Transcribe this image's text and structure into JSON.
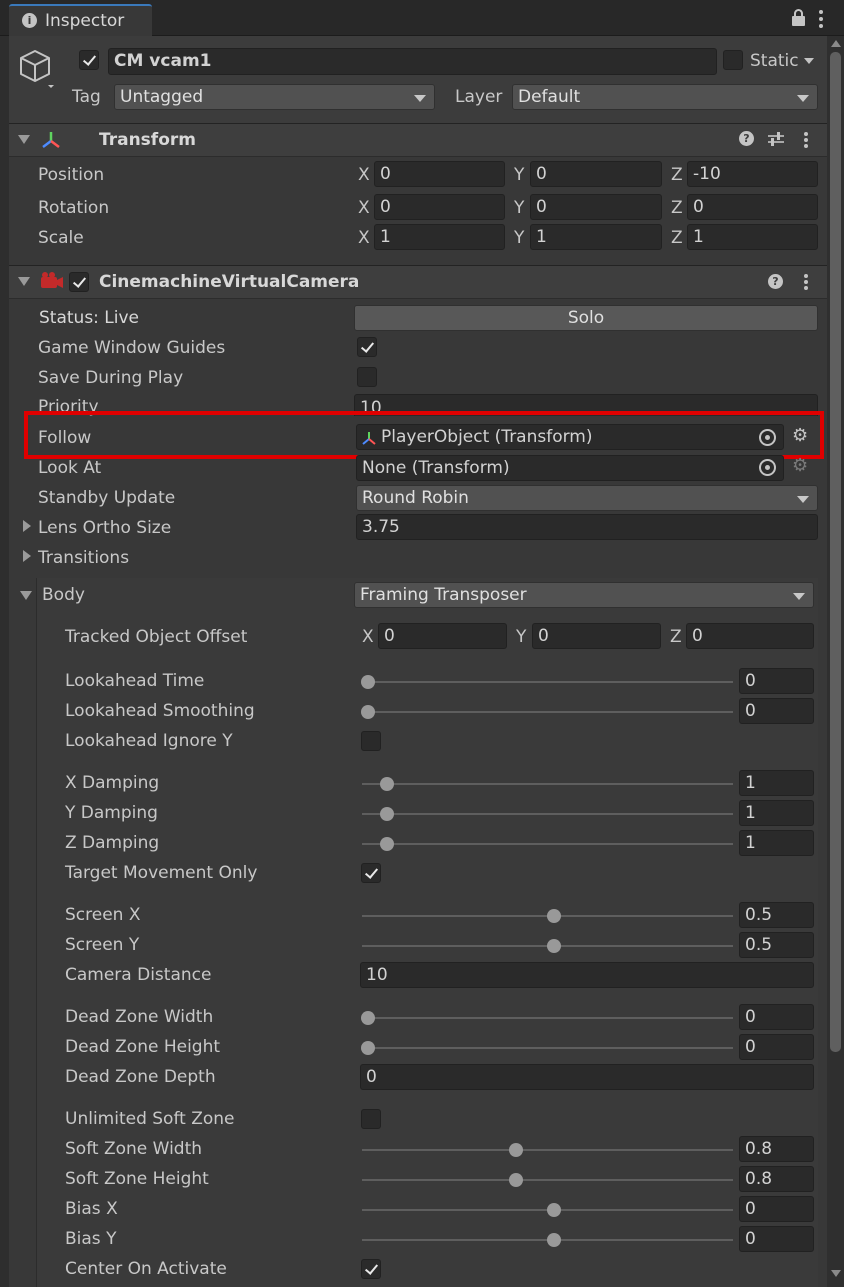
{
  "tab": {
    "title": "Inspector"
  },
  "object": {
    "name": "CM vcam1",
    "static_label": "Static",
    "tag_label": "Tag",
    "tag_value": "Untagged",
    "layer_label": "Layer",
    "layer_value": "Default"
  },
  "transform": {
    "title": "Transform",
    "position": {
      "label": "Position",
      "x": "0",
      "y": "0",
      "z": "-10"
    },
    "rotation": {
      "label": "Rotation",
      "x": "0",
      "y": "0",
      "z": "0"
    },
    "scale": {
      "label": "Scale",
      "x": "1",
      "y": "1",
      "z": "1"
    },
    "axis_x": "X",
    "axis_y": "Y",
    "axis_z": "Z"
  },
  "vcam": {
    "title": "CinemachineVirtualCamera",
    "status_label": "Status: Live",
    "solo_label": "Solo",
    "game_window_guides": "Game Window Guides",
    "save_during_play": "Save During Play",
    "priority_label": "Priority",
    "priority_value": "10",
    "follow_label": "Follow",
    "follow_value": "PlayerObject (Transform)",
    "look_at_label": "Look At",
    "look_at_value": "None (Transform)",
    "standby_label": "Standby Update",
    "standby_value": "Round Robin",
    "lens_label": "Lens Ortho Size",
    "lens_value": "3.75",
    "transitions_label": "Transitions",
    "body_label": "Body",
    "body_value": "Framing Transposer"
  },
  "body": {
    "tracked_offset": {
      "label": "Tracked Object Offset",
      "x": "0",
      "y": "0",
      "z": "0"
    },
    "lookahead_time": {
      "label": "Lookahead Time",
      "value": "0"
    },
    "lookahead_smoothing": {
      "label": "Lookahead Smoothing",
      "value": "0"
    },
    "lookahead_ignore_y": {
      "label": "Lookahead Ignore Y"
    },
    "x_damping": {
      "label": "X Damping",
      "value": "1"
    },
    "y_damping": {
      "label": "Y Damping",
      "value": "1"
    },
    "z_damping": {
      "label": "Z Damping",
      "value": "1"
    },
    "target_movement_only": {
      "label": "Target Movement Only"
    },
    "screen_x": {
      "label": "Screen X",
      "value": "0.5"
    },
    "screen_y": {
      "label": "Screen Y",
      "value": "0.5"
    },
    "camera_distance": {
      "label": "Camera Distance",
      "value": "10"
    },
    "dead_zone_width": {
      "label": "Dead Zone Width",
      "value": "0"
    },
    "dead_zone_height": {
      "label": "Dead Zone Height",
      "value": "0"
    },
    "dead_zone_depth": {
      "label": "Dead Zone Depth",
      "value": "0"
    },
    "unlimited_soft_zone": {
      "label": "Unlimited Soft Zone"
    },
    "soft_zone_width": {
      "label": "Soft Zone Width",
      "value": "0.8"
    },
    "soft_zone_height": {
      "label": "Soft Zone Height",
      "value": "0.8"
    },
    "bias_x": {
      "label": "Bias X",
      "value": "0"
    },
    "bias_y": {
      "label": "Bias Y",
      "value": "0"
    },
    "center_on_activate": {
      "label": "Center On Activate"
    }
  },
  "checkbox_states": {
    "object_active": true,
    "static": false,
    "vcam_enabled": true,
    "game_window_guides": true,
    "save_during_play": false,
    "lookahead_ignore_y": false,
    "target_movement_only": true,
    "unlimited_soft_zone": false,
    "center_on_activate": true
  },
  "icons": {
    "tab": "info-icon",
    "lock": "lock-icon",
    "menu": "kebab-icon",
    "gameobject": "cube-icon",
    "transform": "transform-axes-icon",
    "vcam": "camera-component-icon",
    "help": "help-icon",
    "presets": "sliders-icon",
    "object_picker": "target-icon",
    "settings": "gear-icon"
  },
  "colors": {
    "highlight": "#e00000",
    "background": "#383838",
    "field": "#2a2a2a"
  }
}
